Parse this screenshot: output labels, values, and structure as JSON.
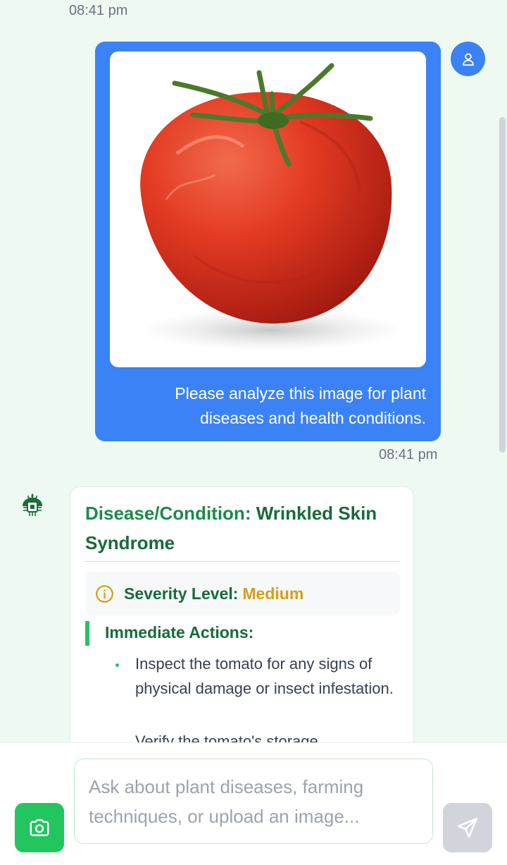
{
  "chat": {
    "top_timestamp": "08:41 pm",
    "user_message": {
      "text": "Please analyze this image for plant diseases and health conditions.",
      "timestamp": "08:41 pm",
      "image_subject": "tomato"
    },
    "bot_message": {
      "title_label": "Disease/Condition:",
      "title_value": "Wrinkled Skin Syndrome",
      "severity_label": "Severity Level:",
      "severity_value": "Medium",
      "actions_title": "Immediate Actions:",
      "actions": [
        "Inspect the tomato for any signs of physical damage or insect infestation.",
        "Verify the tomato's storage"
      ]
    }
  },
  "composer": {
    "placeholder": "Ask about plant diseases, farming techniques, or upload an image...",
    "camera_icon": "camera-icon",
    "send_icon": "send-icon"
  },
  "colors": {
    "background": "#edf9f1",
    "user_bubble": "#3b82f6",
    "accent_green": "#22c55e",
    "title_green": "#176b3a",
    "severity_medium": "#d4a017",
    "send_disabled": "#d1d5db"
  }
}
